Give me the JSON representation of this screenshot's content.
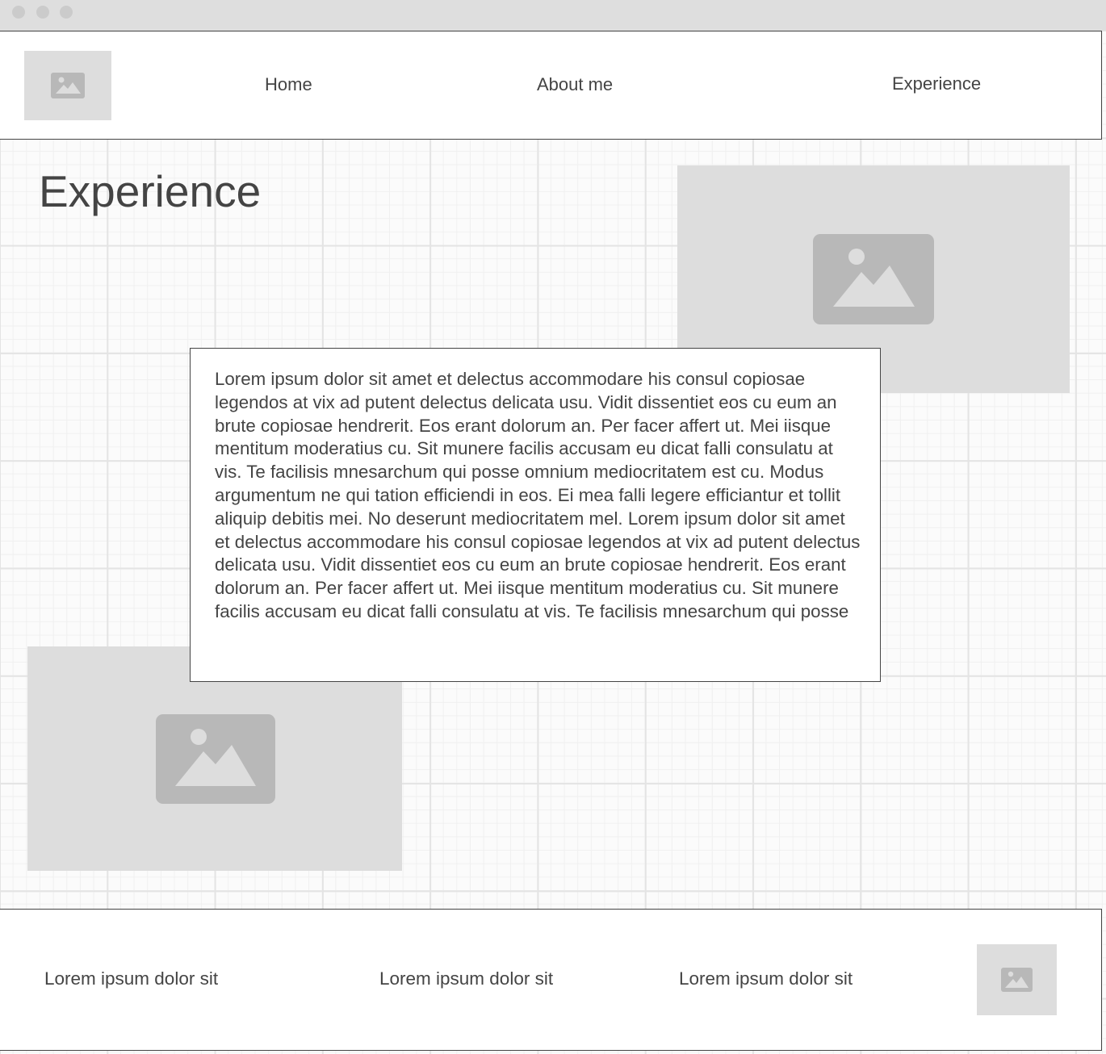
{
  "header": {
    "logo": "image-placeholder-icon",
    "nav": [
      {
        "label": "Home"
      },
      {
        "label": "About me"
      },
      {
        "label": "Experience"
      }
    ]
  },
  "main": {
    "title": "Experience",
    "body_text": "Lorem ipsum dolor sit amet et delectus accommodare his consul copiosae legendos at vix ad putent delectus delicata usu. Vidit dissentiet eos cu eum an brute copiosae hendrerit. Eos erant dolorum an. Per facer affert ut. Mei iisque mentitum moderatius cu. Sit munere facilis accusam eu dicat falli consulatu at vis. Te facilisis mnesarchum qui posse omnium mediocritatem est cu. Modus argumentum ne qui tation efficiendi in eos. Ei mea falli legere efficiantur et tollit aliquip debitis mei. No deserunt mediocritatem mel. Lorem ipsum dolor sit amet et delectus accommodare his consul copiosae legendos at vix ad putent delectus delicata usu. Vidit dissentiet eos cu eum an brute copiosae hendrerit. Eos erant dolorum an. Per facer affert ut. Mei iisque mentitum moderatius cu. Sit munere facilis accusam eu dicat falli consulatu at vis. Te facilisis mnesarchum qui posse",
    "images": [
      "image-placeholder-icon",
      "image-placeholder-icon"
    ]
  },
  "footer": {
    "links": [
      {
        "label": "Lorem ipsum dolor sit"
      },
      {
        "label": "Lorem ipsum dolor sit"
      },
      {
        "label": "Lorem ipsum dolor sit"
      }
    ],
    "logo": "image-placeholder-icon"
  },
  "colors": {
    "placeholder_bg": "#dddddd",
    "placeholder_icon": "#b8b8b8",
    "text": "#444444",
    "border": "#444444"
  }
}
